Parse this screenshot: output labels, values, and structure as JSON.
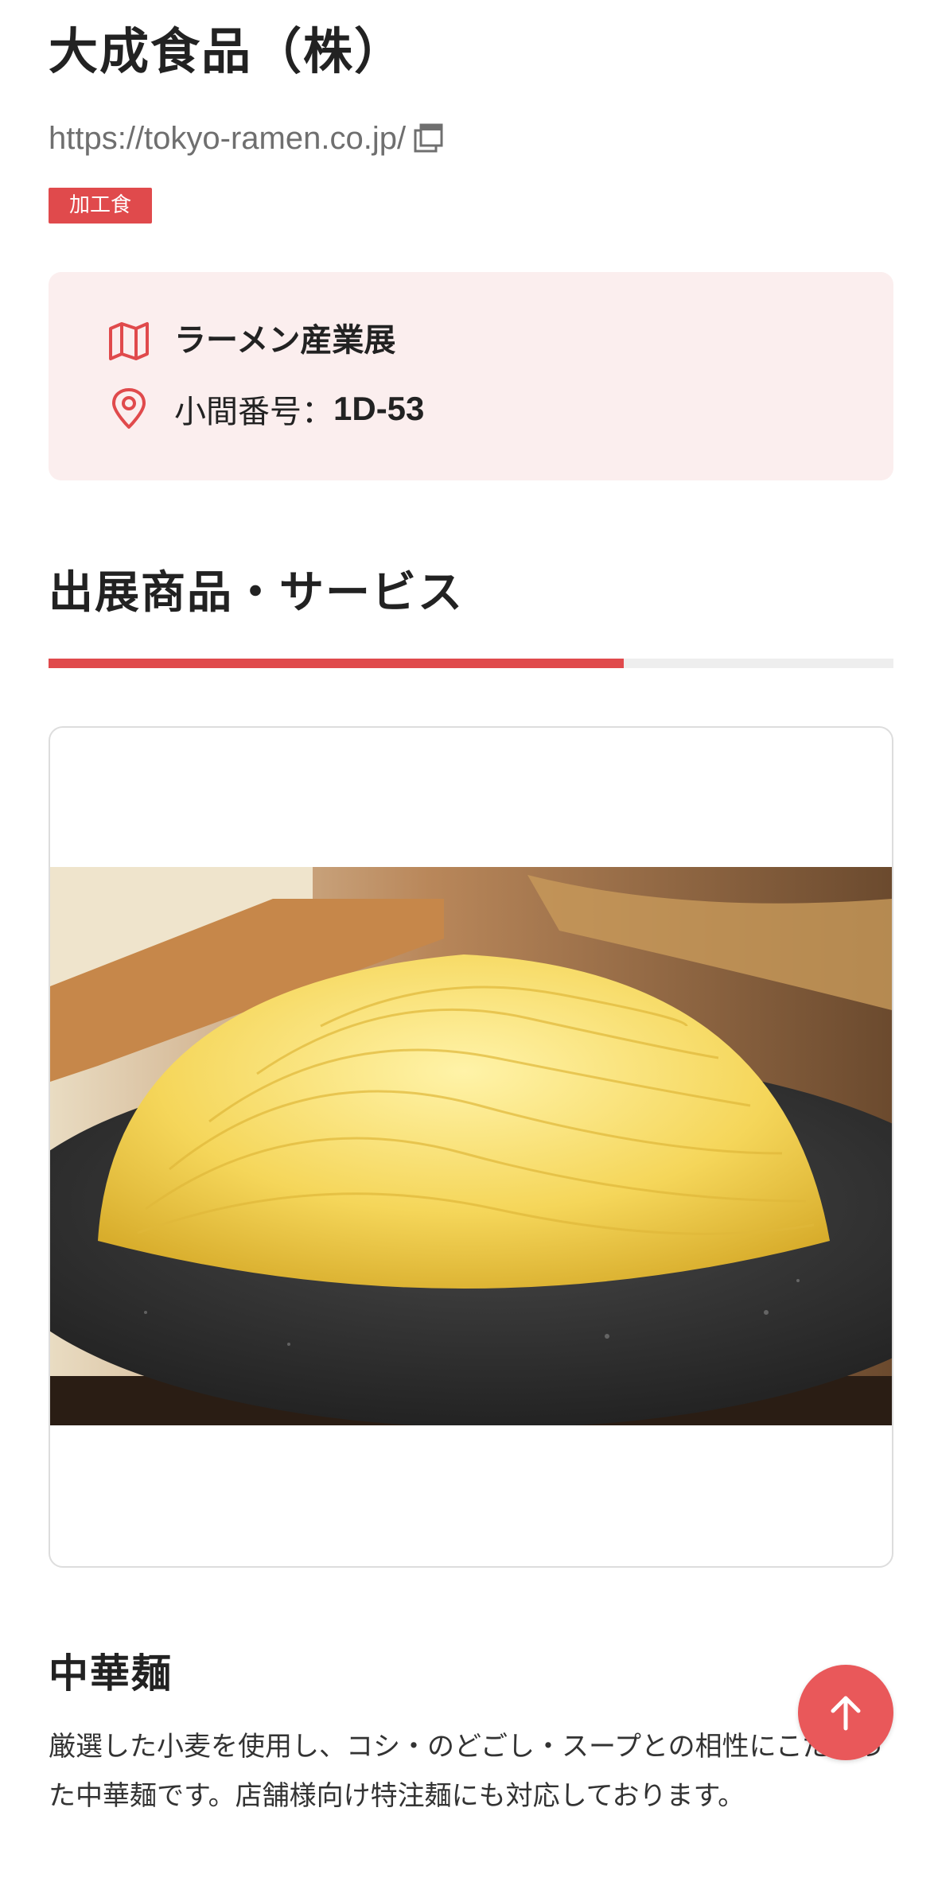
{
  "company": {
    "name": "大成食品（株）",
    "url": "https://tokyo-ramen.co.jp/",
    "tag": "加工食"
  },
  "exhibition": {
    "event_name": "ラーメン産業展",
    "booth_label": "小間番号：",
    "booth_number": "1D-53",
    "icons": [
      "map-icon",
      "location-pin-icon"
    ]
  },
  "section": {
    "title": "出展商品・サービス"
  },
  "product": {
    "name": "中華麺",
    "description": "厳選した小麦を使用し、コシ・のどごし・スープとの相性にこだわった中華麺です。店舗様向け特注麺にも対応しております。",
    "image_icon": "noodle-photo"
  },
  "ui": {
    "scroll_top_icon": "arrow-up-icon"
  },
  "colors": {
    "accent": "#e04a4c",
    "info_bg": "#fbeeee",
    "text": "#222222",
    "muted": "#6f6f6f"
  }
}
